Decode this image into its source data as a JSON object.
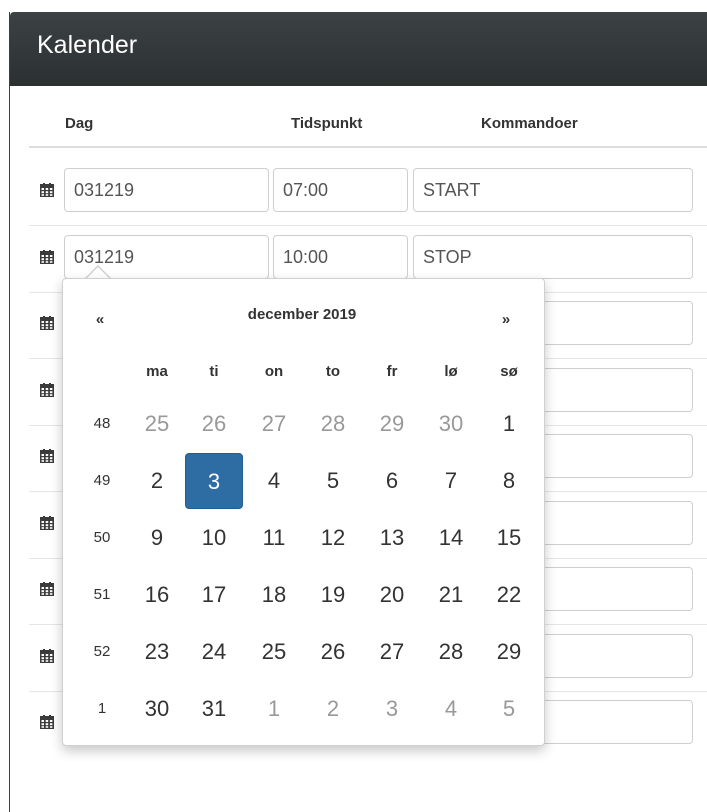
{
  "panel": {
    "title": "Kalender"
  },
  "columns": [
    "Dag",
    "Tidspunkt",
    "Kommandoer"
  ],
  "rows": [
    {
      "day": "031219",
      "time": "07:00",
      "command": "START"
    },
    {
      "day": "031219",
      "time": "10:00",
      "command": "STOP"
    },
    {
      "day": "",
      "time": "",
      "command": ""
    },
    {
      "day": "",
      "time": "",
      "command": ""
    },
    {
      "day": "",
      "time": "",
      "command": ""
    },
    {
      "day": "",
      "time": "",
      "command": ""
    },
    {
      "day": "",
      "time": "",
      "command": ""
    },
    {
      "day": "",
      "time": "",
      "command": ""
    },
    {
      "day": "",
      "time": "",
      "command": ""
    }
  ],
  "datepicker": {
    "prev": "«",
    "next": "»",
    "title": "december 2019",
    "weekdays": [
      "ma",
      "ti",
      "on",
      "to",
      "fr",
      "lø",
      "sø"
    ],
    "weeks": [
      {
        "week": "48",
        "days": [
          "25",
          "26",
          "27",
          "28",
          "29",
          "30",
          "1"
        ],
        "old": [
          true,
          true,
          true,
          true,
          true,
          true,
          false
        ]
      },
      {
        "week": "49",
        "days": [
          "2",
          "3",
          "4",
          "5",
          "6",
          "7",
          "8"
        ],
        "old": [
          false,
          false,
          false,
          false,
          false,
          false,
          false
        ]
      },
      {
        "week": "50",
        "days": [
          "9",
          "10",
          "11",
          "12",
          "13",
          "14",
          "15"
        ],
        "old": [
          false,
          false,
          false,
          false,
          false,
          false,
          false
        ]
      },
      {
        "week": "51",
        "days": [
          "16",
          "17",
          "18",
          "19",
          "20",
          "21",
          "22"
        ],
        "old": [
          false,
          false,
          false,
          false,
          false,
          false,
          false
        ]
      },
      {
        "week": "52",
        "days": [
          "23",
          "24",
          "25",
          "26",
          "27",
          "28",
          "29"
        ],
        "old": [
          false,
          false,
          false,
          false,
          false,
          false,
          false
        ]
      },
      {
        "week": "1",
        "days": [
          "30",
          "31",
          "1",
          "2",
          "3",
          "4",
          "5"
        ],
        "old": [
          false,
          false,
          true,
          true,
          true,
          true,
          true
        ]
      }
    ],
    "selected": "3",
    "accent_color": "#2e6da4"
  },
  "icons": {
    "row": "calendar-icon"
  }
}
